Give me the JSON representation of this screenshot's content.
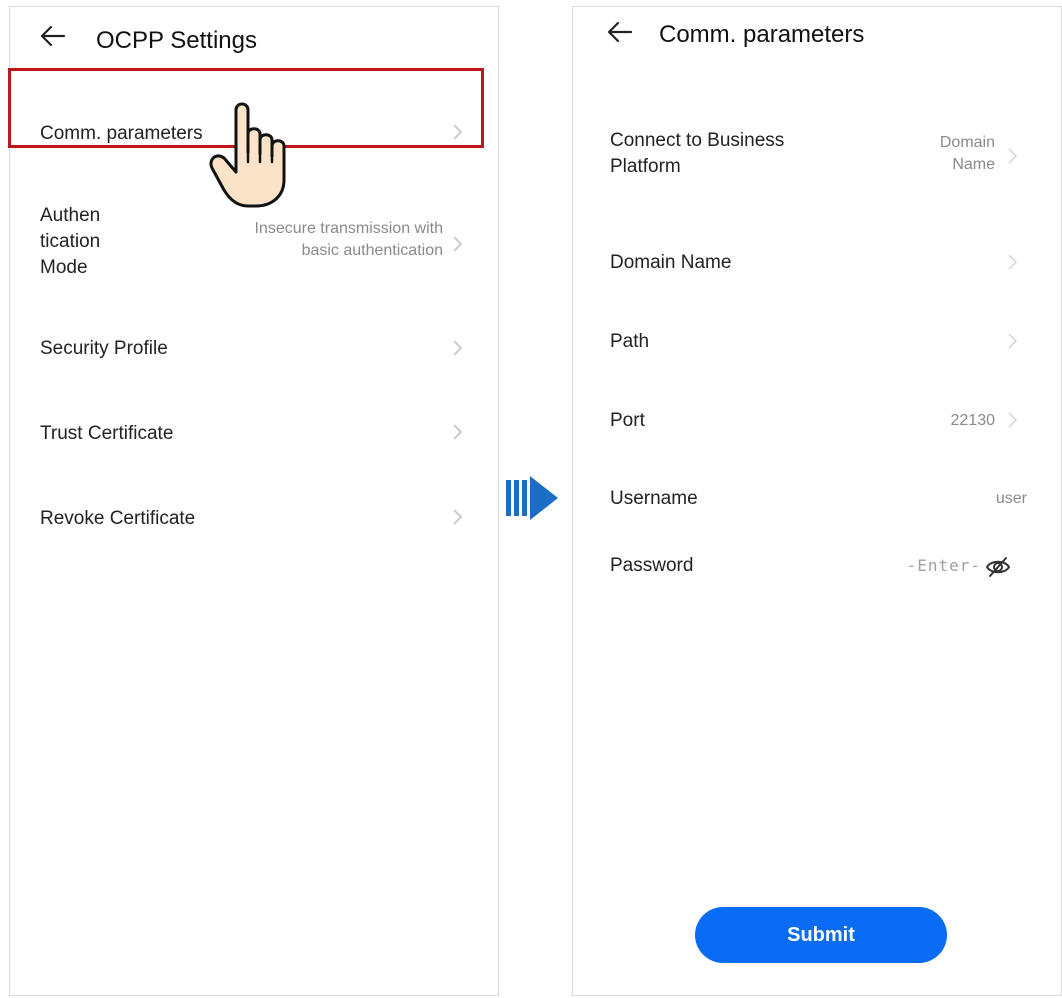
{
  "left_screen": {
    "title": "OCPP Settings",
    "items": [
      {
        "label": "Comm. parameters",
        "value": ""
      },
      {
        "label_lines": [
          "Authen",
          "tication",
          "Mode"
        ],
        "value_lines": [
          "Insecure transmission with",
          "basic authentication"
        ]
      },
      {
        "label": "Security Profile",
        "value": ""
      },
      {
        "label": "Trust Certificate",
        "value": ""
      },
      {
        "label": "Revoke Certificate",
        "value": ""
      }
    ]
  },
  "right_screen": {
    "title": "Comm. parameters",
    "items": [
      {
        "label_lines": [
          "Connect to Business",
          "Platform"
        ],
        "value_lines": [
          "Domain",
          "Name"
        ]
      },
      {
        "label": "Domain Name",
        "value": ""
      },
      {
        "label": "Path",
        "value": ""
      },
      {
        "label": "Port",
        "value": "22130"
      },
      {
        "label": "Username",
        "value": "user"
      },
      {
        "label": "Password",
        "placeholder": "-Enter-"
      }
    ],
    "submit_label": "Submit"
  },
  "colors": {
    "accent": "#0a6cf5",
    "highlight": "#c0171c",
    "flow_arrow": "#1a6fc4",
    "secondary_text": "#8a8a8a"
  },
  "icons": [
    "back-arrow-icon",
    "chevron-right-icon",
    "pointing-hand-icon",
    "flow-arrow-icon",
    "eye-hidden-icon"
  ]
}
